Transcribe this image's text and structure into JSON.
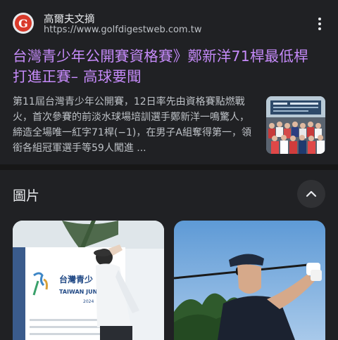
{
  "result": {
    "site_name": "高爾夫文摘",
    "site_url": "https://www.golfdigestweb.com.tw",
    "favicon_letter": "G",
    "title": "台灣青少年公開賽資格賽》鄭新洋71桿最低桿打進正賽– 高球要聞",
    "snippet": "第11屆台灣青少年公開賽，12日率先由資格賽點燃戰火，首次參賽的前淡水球場培訓選手鄭新洋一鳴驚人，締造全場唯一紅字71桿(−1)，在男子A組奪得第一，領銜各組冠軍選手等59人闖進 ...",
    "more_icon": "more-vert-icon"
  },
  "images": {
    "heading": "圖片",
    "collapse_icon": "chevron-up-icon",
    "banner_text_line1": "台灣青少",
    "banner_text_line2": "TAIWAN JUNIO",
    "banner_text_line3": "2024"
  },
  "colors": {
    "background": "#202124",
    "title_visited": "#c58af9",
    "text_primary": "#e8eaed",
    "text_secondary": "#bdc1c6",
    "favicon_red": "#d93a2b"
  }
}
